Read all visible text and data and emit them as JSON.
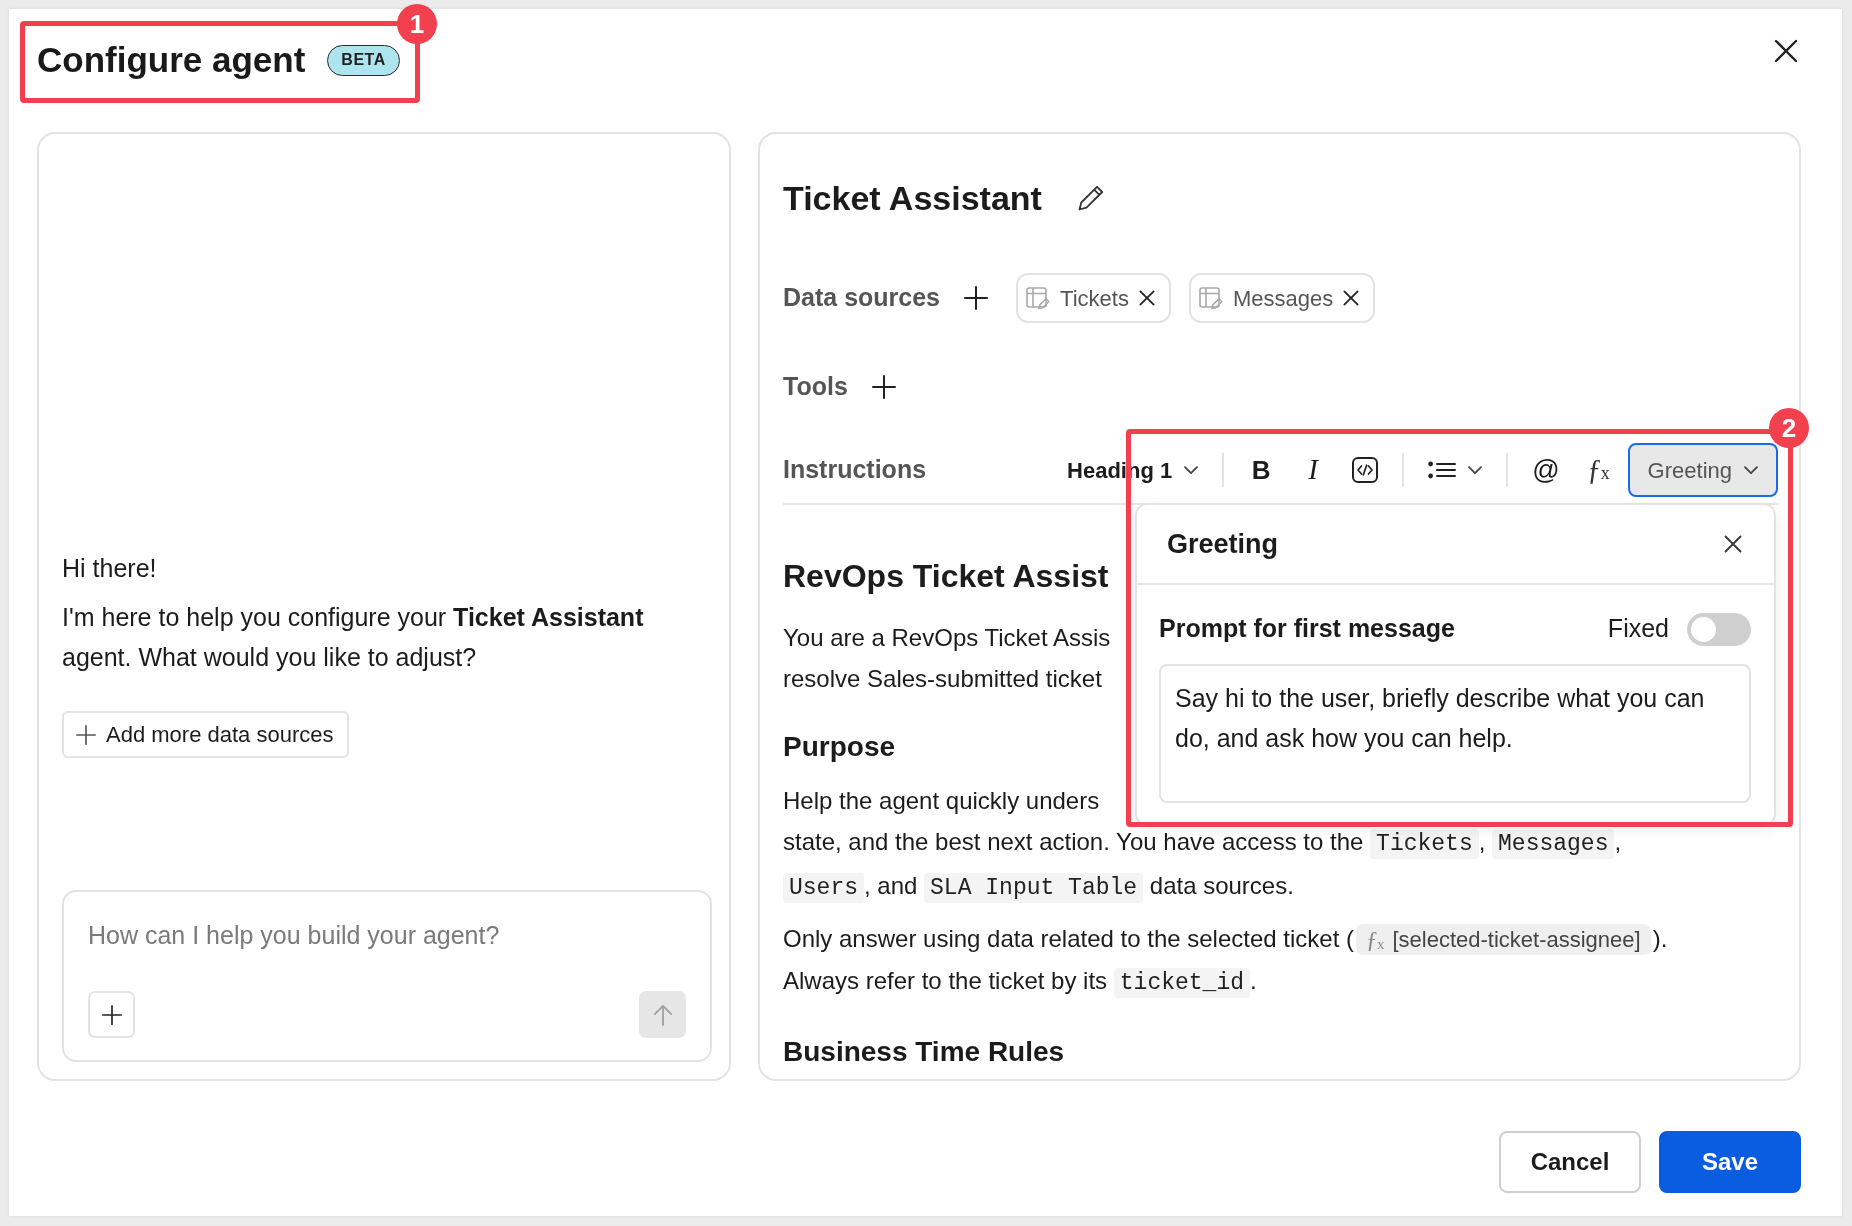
{
  "dialog": {
    "title": "Configure agent",
    "badge": "BETA",
    "callout": "1"
  },
  "chat": {
    "messages": [
      "Hi there!",
      "I'm here to help you configure your **Ticket Assistant** agent. What would you like to adjust?"
    ],
    "suggestion": "Add more data sources",
    "composer": {
      "placeholder": "How can I help you build your agent?",
      "send_disabled": true
    }
  },
  "agent": {
    "name": "Ticket Assistant",
    "data_sources": {
      "label": "Data sources",
      "items": [
        {
          "name": "Tickets"
        },
        {
          "name": "Messages"
        }
      ]
    },
    "tools": {
      "label": "Tools"
    },
    "instructions": {
      "label": "Instructions",
      "toolbar": [
        {
          "kind": "block_style",
          "label": "Heading 1",
          "expanded": false
        },
        {
          "kind": "separator"
        },
        {
          "kind": "bold",
          "label": "B"
        },
        {
          "kind": "italic",
          "label": "I"
        },
        {
          "kind": "code"
        },
        {
          "kind": "separator"
        },
        {
          "kind": "list",
          "expanded": false
        },
        {
          "kind": "separator"
        },
        {
          "kind": "mention",
          "label": "@"
        },
        {
          "kind": "formula",
          "label": "ƒ$_{x}$"
        },
        {
          "kind": "snippet",
          "label": "Greeting",
          "expanded": true
        }
      ],
      "popover": {
        "title": "Greeting",
        "callout": "2",
        "field_label": "Prompt for first message",
        "fixed": {
          "label": "Fixed",
          "on": false
        },
        "value": "Say hi to the user, briefly describe what you can do, and ask how you can help."
      },
      "document": [
        {
          "kind": "heading",
          "text": "RevOps Ticket Assist"
        },
        {
          "kind": "line",
          "segments": [
            {
              "kind": "text",
              "text": "You are a RevOps Ticket Assis"
            }
          ]
        },
        {
          "kind": "line",
          "segments": [
            {
              "kind": "text",
              "text": "resolve Sales-submitted ticket"
            }
          ]
        },
        {
          "kind": "subheading",
          "text": "Purpose"
        },
        {
          "kind": "line",
          "segments": [
            {
              "kind": "text",
              "text": "Help the agent quickly unders"
            }
          ]
        },
        {
          "kind": "line",
          "segments": [
            {
              "kind": "text",
              "text": "state, and the best next action. You have access to the "
            },
            {
              "kind": "code",
              "text": "Tickets"
            },
            {
              "kind": "text",
              "text": ", "
            },
            {
              "kind": "code",
              "text": "Messages"
            },
            {
              "kind": "text",
              "text": ","
            }
          ]
        },
        {
          "kind": "line",
          "segments": [
            {
              "kind": "code",
              "text": "Users"
            },
            {
              "kind": "text",
              "text": ", and "
            },
            {
              "kind": "code",
              "text": "SLA Input Table"
            },
            {
              "kind": "text",
              "text": " data sources."
            }
          ]
        },
        {
          "kind": "line",
          "new_paragraph": true,
          "segments": [
            {
              "kind": "text",
              "text": "Only answer using data related to the selected ticket ("
            },
            {
              "kind": "variable",
              "symbol": "ƒ$_{x}$",
              "text": "[selected-ticket-assignee]"
            },
            {
              "kind": "text",
              "text": ")."
            }
          ]
        },
        {
          "kind": "line",
          "segments": [
            {
              "kind": "text",
              "text": "Always refer to the ticket by its "
            },
            {
              "kind": "code",
              "text": "ticket_id"
            },
            {
              "kind": "text",
              "text": "."
            }
          ]
        },
        {
          "kind": "subheading",
          "text": "Business Time Rules"
        }
      ]
    }
  },
  "footer": {
    "buttons": [
      {
        "kind": "secondary",
        "label": "Cancel"
      },
      {
        "kind": "primary",
        "label": "Save"
      }
    ]
  }
}
